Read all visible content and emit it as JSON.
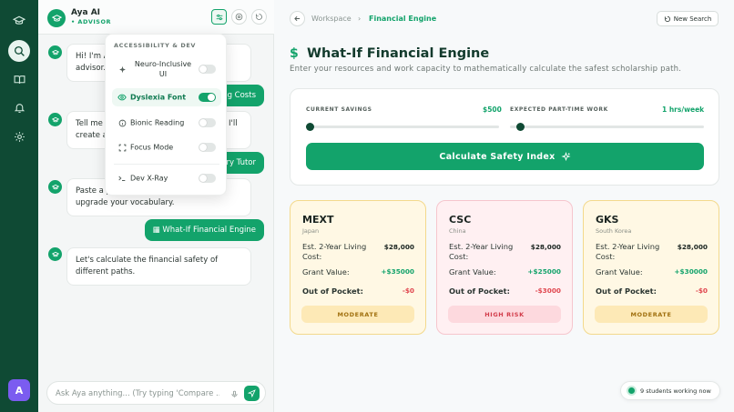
{
  "user_avatar_letter": "A",
  "chat": {
    "ai_name": "Aya AI",
    "ai_role": "• ADVISOR",
    "messages": [
      "Hi! I'm Aya, your scholarship program advisor. How are we feeling today?",
      "Tell me what you want to compare and I'll create a comparison.",
      "Paste a paragraph and I'll help you upgrade your vocabulary.",
      "Let's calculate the financial safety of different paths."
    ],
    "user_messages": [
      "Compare Living Costs",
      "Vocabulary Tutor",
      "What-If Financial Engine"
    ],
    "input_placeholder": "Ask Aya anything... (Try typing 'Compare ..."
  },
  "accessibility_menu": {
    "title": "ACCESSIBILITY & DEV",
    "items": [
      {
        "label": "Neuro-Inclusive UI",
        "on": false
      },
      {
        "label": "Dyslexia Font",
        "on": true
      },
      {
        "label": "Bionic Reading",
        "on": false
      },
      {
        "label": "Focus Mode",
        "on": false
      },
      {
        "label": "Dev X-Ray",
        "on": false
      }
    ]
  },
  "breadcrumb": {
    "root": "Workspace",
    "separator": "›",
    "current": "Financial Engine"
  },
  "new_search_label": "New Search",
  "page": {
    "icon": "$",
    "title": "What-If Financial Engine",
    "subtitle": "Enter your resources and work capacity to mathematically calculate the safest scholarship path."
  },
  "calculator": {
    "savings_label": "CURRENT SAVINGS",
    "savings_value": "$500",
    "savings_fraction": 0.02,
    "work_label": "EXPECTED PART-TIME WORK",
    "work_value": "1 hrs/week",
    "work_fraction": 0.05,
    "button_label": "Calculate Safety Index"
  },
  "labels": {
    "living_cost": "Est. 2-Year Living Cost:",
    "grant_value": "Grant Value:",
    "out_of_pocket": "Out of Pocket:"
  },
  "cards": [
    {
      "name": "MEXT",
      "country": "Japan",
      "living_cost": "$28,000",
      "grant": "+$35000",
      "out_of_pocket": "-$0",
      "risk": "MODERATE"
    },
    {
      "name": "CSC",
      "country": "China",
      "living_cost": "$28,000",
      "grant": "+$25000",
      "out_of_pocket": "-$3000",
      "risk": "HIGH RISK"
    },
    {
      "name": "GKS",
      "country": "South Korea",
      "living_cost": "$28,000",
      "grant": "+$30000",
      "out_of_pocket": "-$0",
      "risk": "MODERATE"
    }
  ],
  "online_status": "9 students working now",
  "colors": {
    "accent": "#13a36b",
    "rail": "#0f4a34",
    "danger": "#e0464f",
    "moderate_bg": "#fff7dd",
    "risk_bg": "#fdebee"
  },
  "icons": [
    "graduation-cap-icon",
    "search-icon",
    "book-icon",
    "bell-icon",
    "gear-icon",
    "sliders-icon",
    "eye-icon",
    "refresh-icon",
    "mic-icon",
    "send-icon",
    "arrow-left-icon",
    "sparkle-icon"
  ]
}
